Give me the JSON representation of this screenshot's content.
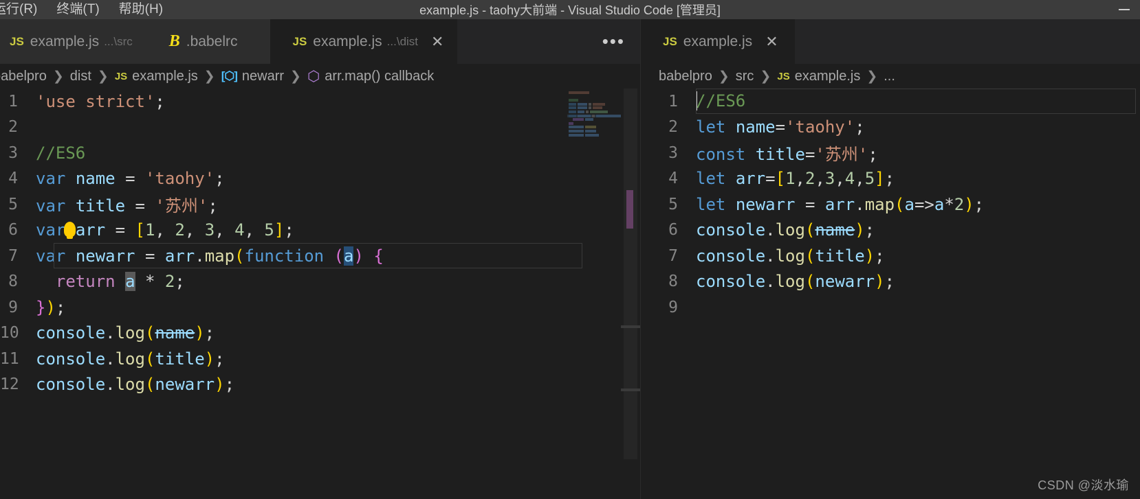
{
  "window": {
    "title": "example.js - taohy大前端 - Visual Studio Code [管理员]",
    "menu": [
      {
        "label": "运行(R)",
        "key": "R"
      },
      {
        "label": "终端(T)",
        "key": "T"
      },
      {
        "label": "帮助(H)",
        "key": "H"
      }
    ],
    "minimize_label": "—"
  },
  "left_group": {
    "tabs": [
      {
        "icon": "js-file-icon",
        "icon_text": "JS",
        "label": "example.js",
        "description": "...\\src",
        "active": false,
        "closable": false
      },
      {
        "icon": "babel-file-icon",
        "icon_text": "B",
        "label": ".babelrc",
        "description": "",
        "active": false,
        "closable": false
      },
      {
        "icon": "js-file-icon",
        "icon_text": "JS",
        "label": "example.js",
        "description": "...\\dist",
        "active": true,
        "closable": true,
        "close_label": "✕"
      }
    ],
    "more_actions_label": "•••",
    "breadcrumb": [
      {
        "type": "text",
        "label": "babelpro"
      },
      {
        "type": "text",
        "label": "dist"
      },
      {
        "type": "js",
        "icon_text": "JS",
        "label": "example.js"
      },
      {
        "type": "variable",
        "icon_text": "[⬡]",
        "label": "newarr"
      },
      {
        "type": "function",
        "icon_text": "⬡",
        "label": "arr.map() callback"
      }
    ],
    "code": [
      {
        "n": "1",
        "text": "'use strict';"
      },
      {
        "n": "2",
        "text": ""
      },
      {
        "n": "3",
        "text": "//ES6"
      },
      {
        "n": "4",
        "text": "var name = 'taohy';"
      },
      {
        "n": "5",
        "text": "var title = '苏州';"
      },
      {
        "n": "6",
        "text": "var arr = [1, 2, 3, 4, 5];"
      },
      {
        "n": "7",
        "text": "var newarr = arr.map(function (a) {"
      },
      {
        "n": "8",
        "text": "  return a * 2;"
      },
      {
        "n": "9",
        "text": "});"
      },
      {
        "n": "10",
        "text": "console.log(name);"
      },
      {
        "n": "11",
        "text": "console.log(title);"
      },
      {
        "n": "12",
        "text": "console.log(newarr);"
      }
    ]
  },
  "right_group": {
    "tabs": [
      {
        "icon": "js-file-icon",
        "icon_text": "JS",
        "label": "example.js",
        "description": "",
        "active": true,
        "closable": true,
        "close_label": "✕"
      }
    ],
    "breadcrumb": [
      {
        "type": "text",
        "label": "babelpro"
      },
      {
        "type": "text",
        "label": "src"
      },
      {
        "type": "js",
        "icon_text": "JS",
        "label": "example.js"
      },
      {
        "type": "ellipsis",
        "label": "..."
      }
    ],
    "code": [
      {
        "n": "1",
        "text": "//ES6"
      },
      {
        "n": "2",
        "text": "let name='taohy';"
      },
      {
        "n": "3",
        "text": "const title='苏州';"
      },
      {
        "n": "4",
        "text": "let arr=[1,2,3,4,5];"
      },
      {
        "n": "5",
        "text": "let newarr = arr.map(a=>a*2);"
      },
      {
        "n": "6",
        "text": "console.log(name);"
      },
      {
        "n": "7",
        "text": "console.log(title);"
      },
      {
        "n": "8",
        "text": "console.log(newarr);"
      },
      {
        "n": "9",
        "text": ""
      }
    ]
  },
  "watermark": {
    "text": "CSDN @淡水瑜"
  },
  "colors": {
    "titlebar_bg": "#3c3c3c",
    "tabbar_bg": "#252526",
    "tab_inactive_bg": "#2d2d2d",
    "editor_bg": "#1e1e1e",
    "keyword": "#569cd6",
    "keyword_control": "#c586c0",
    "variable": "#9cdcfe",
    "string": "#ce9178",
    "number": "#b5cea8",
    "comment": "#6a9955",
    "function": "#dcdcaa",
    "bracket_yellow": "#ffd700",
    "bracket_pink": "#da70d6",
    "bracket_blue": "#179fff",
    "line_number": "#858585",
    "selection": "#264f78",
    "js_icon": "#cbcb41",
    "babel_icon": "#f5de19"
  }
}
